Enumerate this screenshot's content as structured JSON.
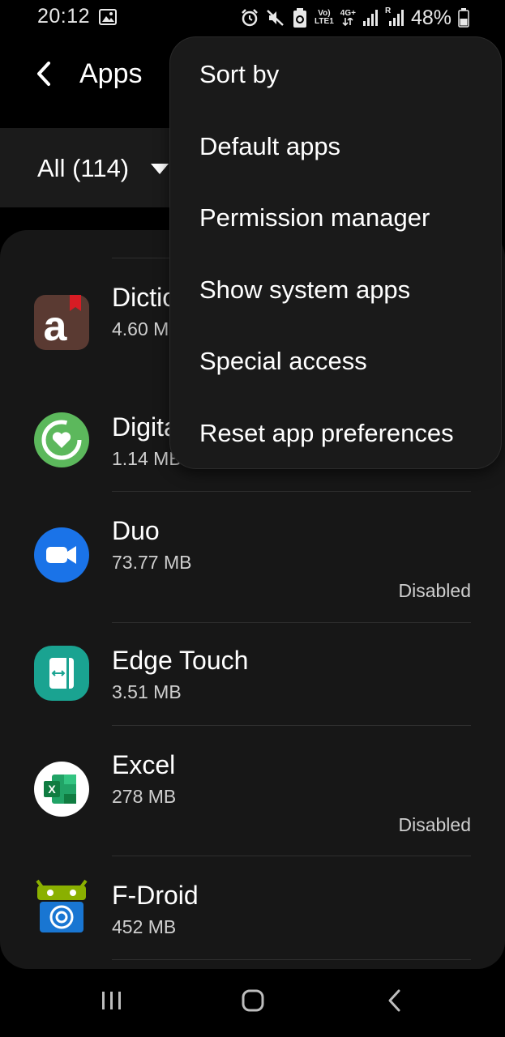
{
  "status_bar": {
    "time": "20:12",
    "battery": "48%",
    "network_label_top": "Vo)",
    "network_label_bottom": "LTE1",
    "net_type": "4G+",
    "roaming_label": "R",
    "icons": [
      "gallery-icon",
      "alarm-icon",
      "mute-icon",
      "data-saver-icon",
      "volte-icon",
      "4g-plus-icon",
      "signal-icon",
      "roaming-signal-icon",
      "battery-icon"
    ]
  },
  "header": {
    "title": "Apps"
  },
  "filter": {
    "label": "All (114)"
  },
  "apps": [
    {
      "name": "Dictionary",
      "size": "4.60 MB",
      "status": ""
    },
    {
      "name": "Digital Wellbeing",
      "size": "1.14 MB",
      "status": ""
    },
    {
      "name": "Duo",
      "size": "73.77 MB",
      "status": "Disabled"
    },
    {
      "name": "Edge Touch",
      "size": "3.51 MB",
      "status": ""
    },
    {
      "name": "Excel",
      "size": "278 MB",
      "status": "Disabled"
    },
    {
      "name": "F-Droid",
      "size": "452 MB",
      "status": ""
    }
  ],
  "menu": {
    "items": [
      "Sort by",
      "Default apps",
      "Permission manager",
      "Show system apps",
      "Special access",
      "Reset app preferences"
    ]
  },
  "nav": {
    "icons": [
      "recents-icon",
      "home-icon",
      "back-nav-icon"
    ]
  },
  "colors": {
    "background": "#000000",
    "card": "#171717",
    "menu": "#1a1a1a",
    "divider": "#2e2e2e",
    "duo_blue": "#1a73e8",
    "edge_teal": "#1aa391",
    "excel_green": "#107c41",
    "wellbeing_green": "#5cb85c"
  }
}
